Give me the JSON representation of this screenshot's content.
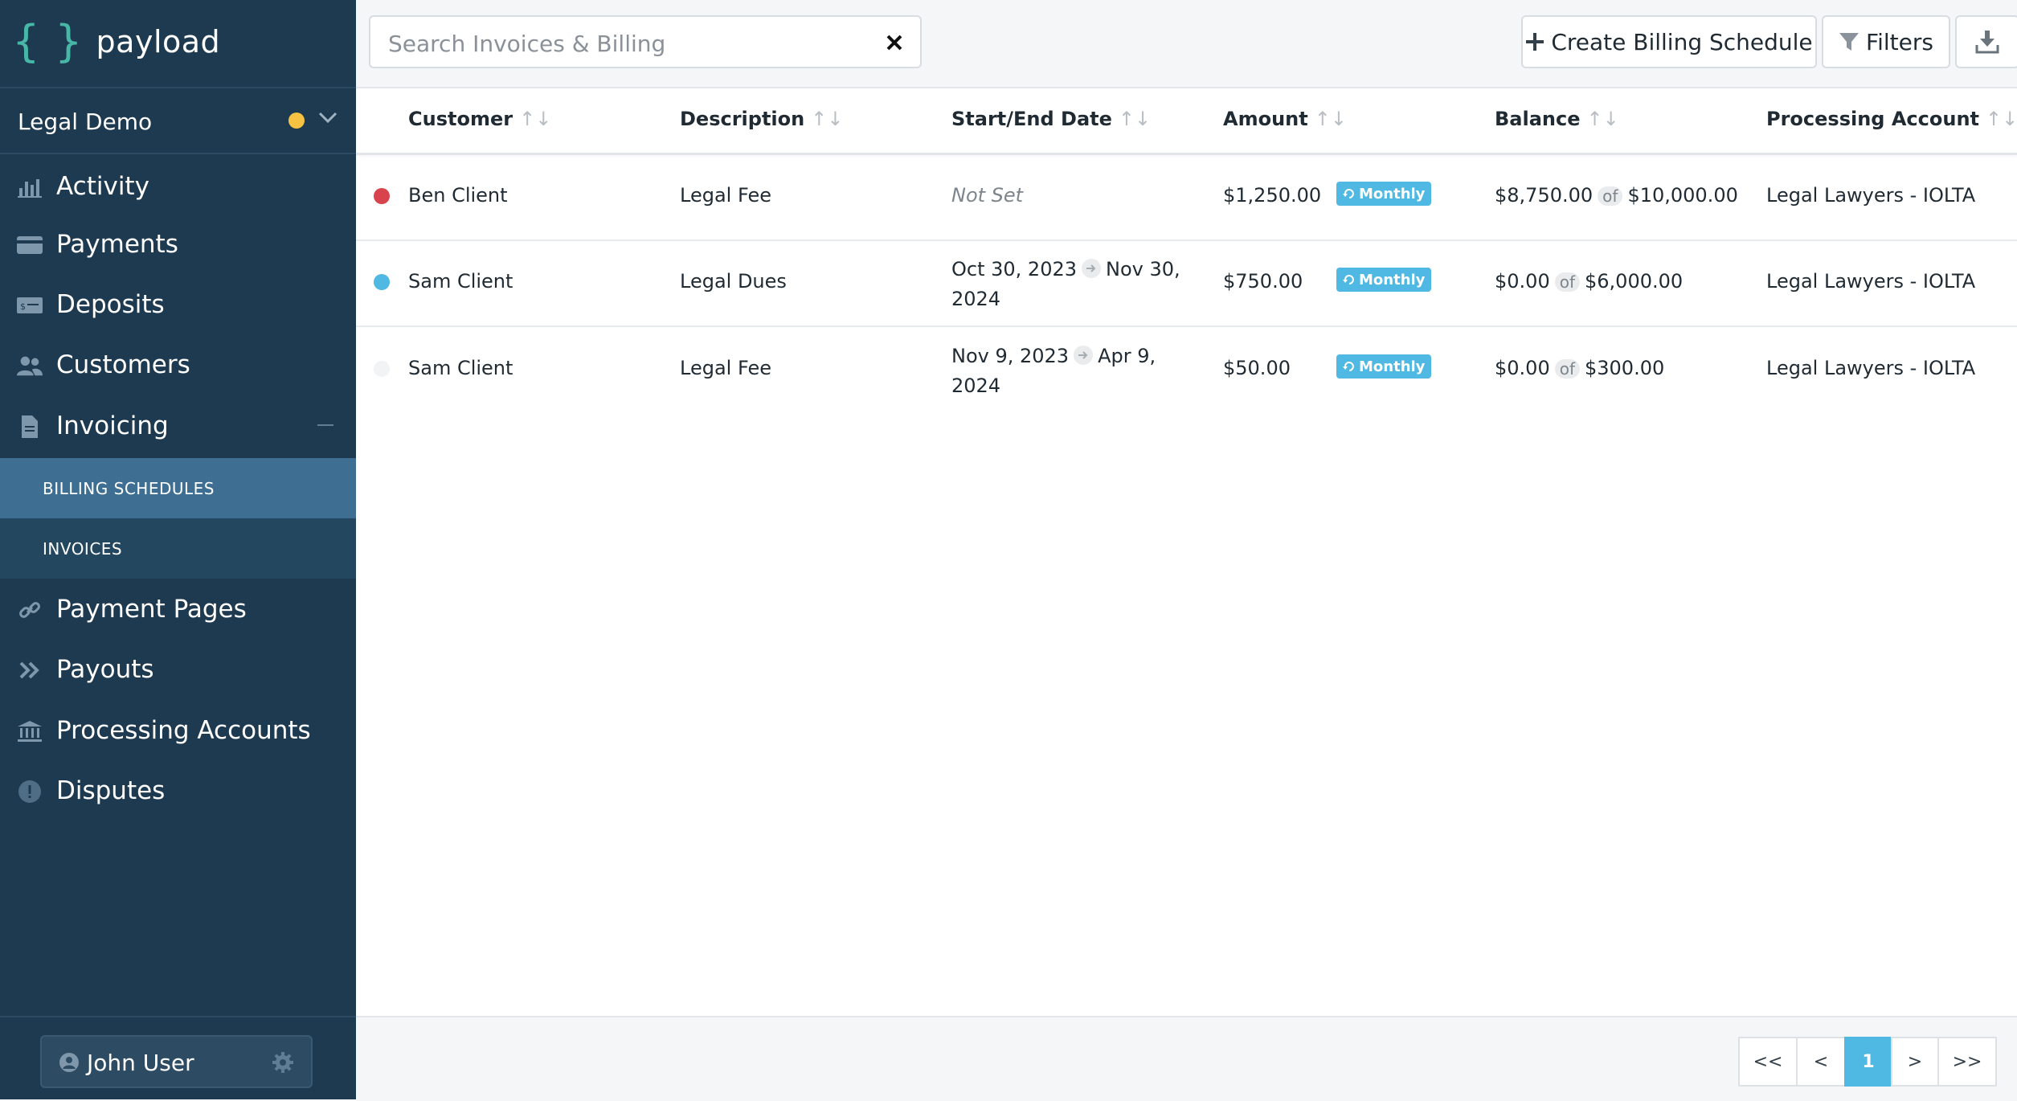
{
  "brand": {
    "name": "payload",
    "braces": "{ }"
  },
  "workspace": {
    "name": "Legal Demo",
    "status_color": "#f5c242"
  },
  "nav": {
    "items": [
      {
        "label": "Activity",
        "icon": "bar-chart-icon"
      },
      {
        "label": "Payments",
        "icon": "credit-card-icon"
      },
      {
        "label": "Deposits",
        "icon": "deposit-icon"
      },
      {
        "label": "Customers",
        "icon": "users-icon"
      },
      {
        "label": "Invoicing",
        "icon": "document-icon"
      },
      {
        "label": "Payment Pages",
        "icon": "link-icon"
      },
      {
        "label": "Payouts",
        "icon": "double-chevron-icon"
      },
      {
        "label": "Processing Accounts",
        "icon": "bank-icon"
      },
      {
        "label": "Disputes",
        "icon": "alert-icon"
      }
    ],
    "submenu": [
      {
        "label": "BILLING SCHEDULES",
        "active": true
      },
      {
        "label": "INVOICES",
        "active": false
      }
    ]
  },
  "user": {
    "name": "John User"
  },
  "search": {
    "placeholder": "Search Invoices & Billing",
    "value": ""
  },
  "toolbar": {
    "create_label": "Create Billing Schedule",
    "filters_label": "Filters"
  },
  "table": {
    "columns": [
      "Customer",
      "Description",
      "Start/End Date",
      "Amount",
      "Balance",
      "Processing Account"
    ],
    "rows": [
      {
        "status_color": "#d9434e",
        "customer": "Ben Client",
        "description": "Legal Fee",
        "date_not_set": "Not Set",
        "amount": "$1,250.00",
        "frequency": "Monthly",
        "balance": "$8,750.00",
        "of": "of",
        "total": "$10,000.00",
        "account": "Legal Lawyers - IOLTA"
      },
      {
        "status_color": "#4fb8e3",
        "customer": "Sam Client",
        "description": "Legal Dues",
        "start": "Oct 30, 2023",
        "end_a": "Nov 30,",
        "end_b": "2024",
        "amount": "$750.00",
        "frequency": "Monthly",
        "balance": "$0.00",
        "of": "of",
        "total": "$6,000.00",
        "account": "Legal Lawyers - IOLTA"
      },
      {
        "status_color": "#f2f3f4",
        "customer": "Sam Client",
        "description": "Legal Fee",
        "start": "Nov 9, 2023",
        "end_a": "Apr 9,",
        "end_b": "2024",
        "amount": "$50.00",
        "frequency": "Monthly",
        "balance": "$0.00",
        "of": "of",
        "total": "$300.00",
        "account": "Legal Lawyers - IOLTA"
      }
    ]
  },
  "pagination": {
    "first": "<<",
    "prev": "<",
    "current": "1",
    "next": ">",
    "last": ">>"
  },
  "colors": {
    "sidebar": "#1e3a50",
    "accent": "#4fb8e3",
    "brand": "#47b8a8"
  }
}
